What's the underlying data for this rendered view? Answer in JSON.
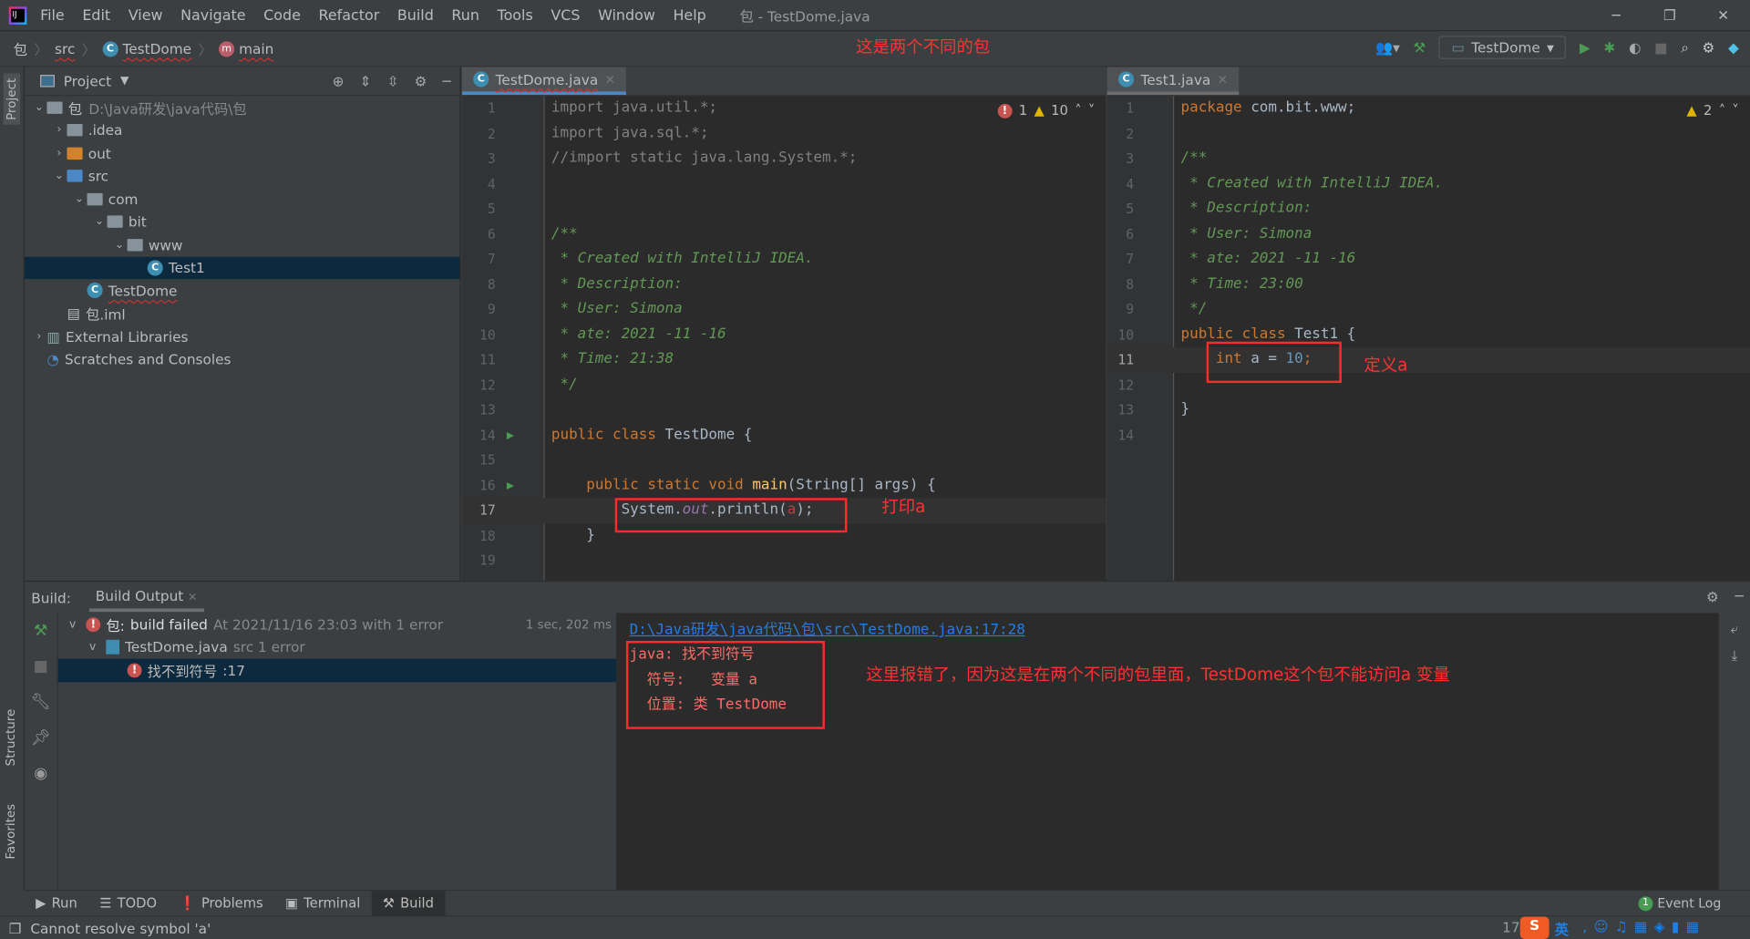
{
  "window": {
    "title": "包 - TestDome.java",
    "menu": [
      "File",
      "Edit",
      "View",
      "Navigate",
      "Code",
      "Refactor",
      "Build",
      "Run",
      "Tools",
      "VCS",
      "Window",
      "Help"
    ]
  },
  "breadcrumb": [
    "包",
    "src",
    "TestDome",
    "main"
  ],
  "annotations": {
    "top": "这是两个不同的包",
    "print_a": "打印a",
    "define_a": "定义a",
    "error_note": "这里报错了，因为这是在两个不同的包里面，TestDome这个包不能访问a 变量"
  },
  "toolbar": {
    "run_config": "TestDome"
  },
  "side_tabs": {
    "project": "Project",
    "structure": "Structure",
    "favorites": "Favorites"
  },
  "project": {
    "title": "Project",
    "tree": [
      {
        "label": "包",
        "suffix": "D:\\Java研发\\java代码\\包",
        "depth": 0,
        "arrow": "v",
        "icon": "folder"
      },
      {
        "label": ".idea",
        "depth": 1,
        "arrow": ">",
        "icon": "folder"
      },
      {
        "label": "out",
        "depth": 1,
        "arrow": ">",
        "icon": "folder-orange"
      },
      {
        "label": "src",
        "depth": 1,
        "arrow": "v",
        "icon": "folder-blue"
      },
      {
        "label": "com",
        "depth": 2,
        "arrow": "v",
        "icon": "package"
      },
      {
        "label": "bit",
        "depth": 3,
        "arrow": "v",
        "icon": "package"
      },
      {
        "label": "www",
        "depth": 4,
        "arrow": "v",
        "icon": "package"
      },
      {
        "label": "Test1",
        "depth": 5,
        "arrow": "",
        "icon": "class",
        "selected": true
      },
      {
        "label": "TestDome",
        "depth": 2,
        "arrow": "",
        "icon": "class",
        "error": true
      },
      {
        "label": "包.iml",
        "depth": 1,
        "arrow": "",
        "icon": "iml"
      },
      {
        "label": "External Libraries",
        "depth": 0,
        "arrow": ">",
        "icon": "libraries"
      },
      {
        "label": "Scratches and Consoles",
        "depth": 0,
        "arrow": "",
        "icon": "scratches"
      }
    ]
  },
  "editor_left": {
    "tab": "TestDome.java",
    "errors": "1",
    "warnings": "10",
    "current_line": 17,
    "lines": [
      [
        [
          "import java.util.*;",
          "unused"
        ]
      ],
      [
        [
          "import java.sql.*;",
          "unused"
        ]
      ],
      [
        [
          "//import static java.lang.System.*;",
          "gr"
        ]
      ],
      [],
      [],
      [
        [
          "/**",
          "cm"
        ]
      ],
      [
        [
          " * Created with IntelliJ IDEA.",
          "cm"
        ]
      ],
      [
        [
          " * Description:",
          "cm"
        ]
      ],
      [
        [
          " * User: Simona",
          "cm"
        ]
      ],
      [
        [
          " * ate: 2021 -11 -16",
          "cm"
        ]
      ],
      [
        [
          " * Time: 21:38",
          "cm"
        ]
      ],
      [
        [
          " */",
          "cm"
        ]
      ],
      [],
      [
        [
          "public class ",
          "kw"
        ],
        [
          "TestDome {",
          "tx"
        ]
      ],
      [],
      [
        [
          "    public static void ",
          "kw"
        ],
        [
          "main",
          "fn"
        ],
        [
          "(String[] args) {",
          "tx"
        ]
      ],
      [
        [
          "        System.",
          "tx"
        ],
        [
          "out",
          "fld"
        ],
        [
          ".println(",
          "tx"
        ],
        [
          "a",
          "err"
        ],
        [
          ");",
          "tx"
        ]
      ],
      [
        [
          "    }",
          "tx"
        ]
      ],
      []
    ]
  },
  "editor_right": {
    "tab": "Test1.java",
    "warnings": "2",
    "current_line": 11,
    "lines": [
      [
        [
          "package ",
          "kw"
        ],
        [
          "com.bit.www;",
          "tx"
        ]
      ],
      [],
      [
        [
          "/**",
          "cm"
        ]
      ],
      [
        [
          " * Created with IntelliJ IDEA.",
          "cm"
        ]
      ],
      [
        [
          " * Description:",
          "cm"
        ]
      ],
      [
        [
          " * User: Simona",
          "cm"
        ]
      ],
      [
        [
          " * ate: 2021 -11 -16",
          "cm"
        ]
      ],
      [
        [
          " * Time: 23:00",
          "cm"
        ]
      ],
      [
        [
          " */",
          "cm"
        ]
      ],
      [
        [
          "public class ",
          "kw"
        ],
        [
          "Test1 {",
          "tx"
        ]
      ],
      [
        [
          "    int ",
          "kw"
        ],
        [
          "a = ",
          "tx"
        ],
        [
          "10",
          "num"
        ],
        [
          ";",
          "kw"
        ]
      ],
      [],
      [
        [
          "}",
          "tx"
        ]
      ],
      []
    ]
  },
  "build": {
    "label": "Build:",
    "tab": "Build Output",
    "root": {
      "name": "包:",
      "status": "build failed",
      "detail": "At 2021/11/16 23:03 with 1 error",
      "time": "1 sec, 202 ms"
    },
    "file": {
      "name": "TestDome.java",
      "detail": "src 1 error"
    },
    "error": {
      "name": "找不到符号",
      "line": ":17"
    },
    "output": {
      "link": "D:\\Java研发\\java代码\\包\\src\\TestDome.java:17:28",
      "lines": [
        "java: 找不到符号",
        "  符号:   变量 a",
        "  位置: 类 TestDome"
      ]
    }
  },
  "tool_tabs": [
    "Run",
    "TODO",
    "Problems",
    "Terminal",
    "Build"
  ],
  "status": {
    "message": "Cannot resolve symbol 'a'",
    "event_log": "Event Log",
    "event_count": "1",
    "position": "17",
    "ime": "英"
  },
  "colors": {
    "accent": "#4a88c7",
    "error": "#c75450",
    "annotation": "#ff2b2b"
  }
}
